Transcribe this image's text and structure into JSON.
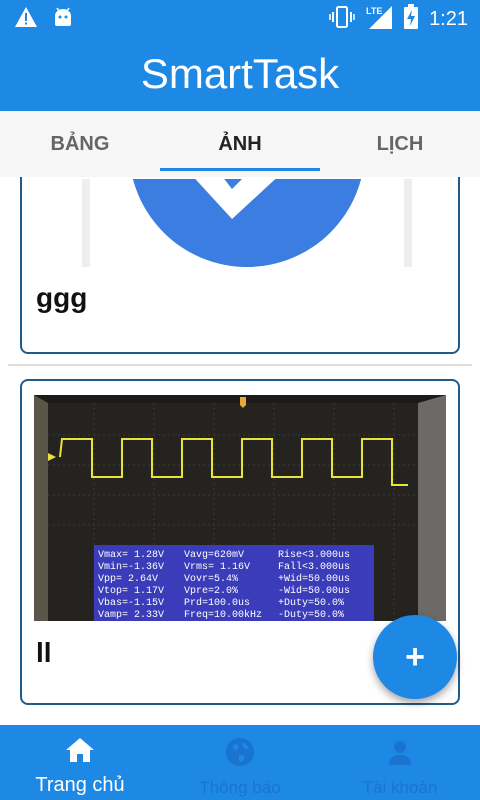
{
  "status_bar": {
    "time": "1:21",
    "icons": [
      "warning-icon",
      "android-icon",
      "vibrate-icon",
      "lte-signal-icon",
      "battery-charging-icon"
    ],
    "signal_label": "LTE"
  },
  "app_bar": {
    "title": "SmartTask"
  },
  "tabs": [
    {
      "label": "BẢNG",
      "active": false
    },
    {
      "label": "ẢNH",
      "active": true
    },
    {
      "label": "LỊCH",
      "active": false
    }
  ],
  "cards": [
    {
      "title": "ggg",
      "image": "check-mark-image"
    },
    {
      "title": "ll",
      "image": "oscilloscope-photo"
    }
  ],
  "scope_readout": [
    [
      "Vmax= 1.28V",
      "Vavg=620mV",
      "Rise<3.000us"
    ],
    [
      "Vmin=-1.36V",
      "Vrms= 1.16V",
      "Fall<3.000us"
    ],
    [
      "Vpp= 2.64V",
      "Vovr=5.4%",
      "+Wid=50.00us"
    ],
    [
      "Vtop= 1.17V",
      "Vpre=2.0%",
      "-Wid=50.00us"
    ],
    [
      "Vbas=-1.15V",
      "Prd=100.0us",
      "+Duty=50.0%"
    ],
    [
      "Vamp= 2.33V",
      "Freq=10.00kHz",
      "-Duty=50.0%"
    ]
  ],
  "fab": {
    "label": "+"
  },
  "bottom_nav": [
    {
      "label": "Trang chủ",
      "icon": "home-icon",
      "active": true
    },
    {
      "label": "Thông báo",
      "icon": "globe-icon",
      "active": false
    },
    {
      "label": "Tài khoản",
      "icon": "person-icon",
      "active": false
    }
  ],
  "colors": {
    "primary": "#1e88e5",
    "card_border": "#1f5c8c",
    "tab_indicator": "#1e88e5",
    "scope_trace": "#e8e23a",
    "scope_panel": "#3d3fc7"
  }
}
